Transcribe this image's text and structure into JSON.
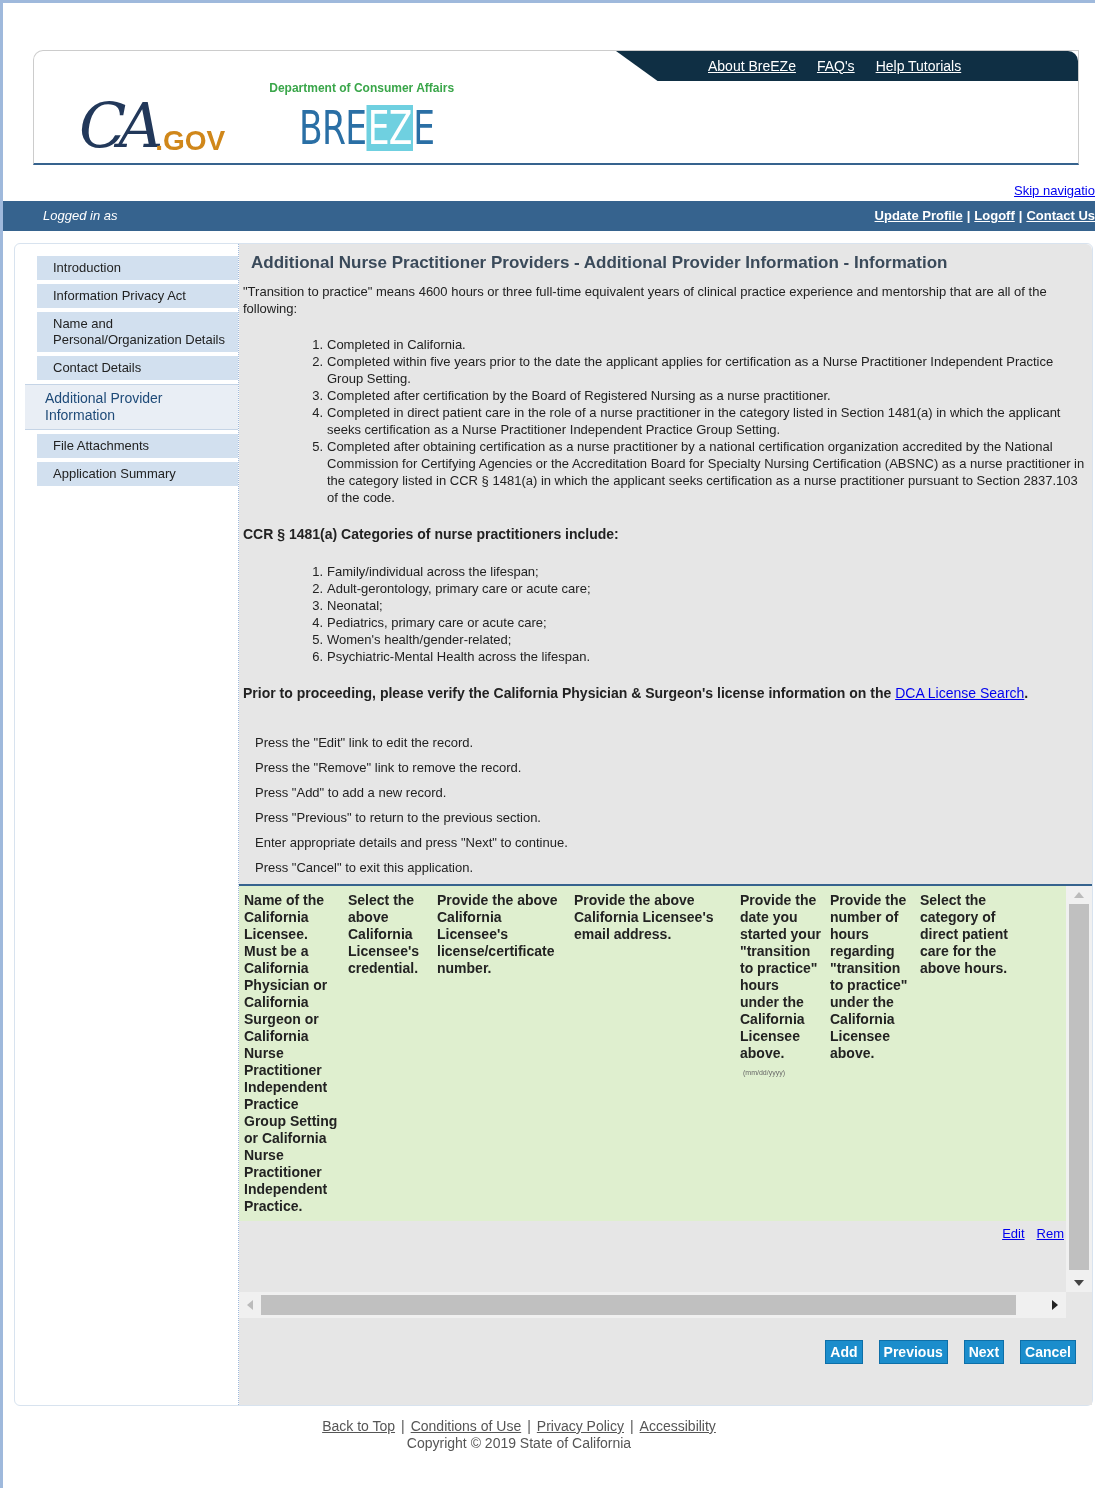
{
  "header": {
    "nav_links": [
      "About BreEZe",
      "FAQ's",
      "Help Tutorials"
    ],
    "ca_logo": {
      "main": "CA",
      ".gov": ".GOV"
    },
    "department": "Department of Consumer Affairs",
    "breeze_logo": [
      "BRE",
      "EZ",
      "E"
    ]
  },
  "skip_link": "Skip navigatio",
  "user_bar": {
    "logged_in": "Logged in as",
    "separator": "|",
    "links": [
      "Update Profile",
      "Logoff",
      "Contact Us"
    ]
  },
  "sidebar": {
    "items": [
      {
        "label": "Introduction",
        "selected": false
      },
      {
        "label": "Information Privacy Act",
        "selected": false
      },
      {
        "label": "Name and Personal/Organization Details",
        "selected": false
      },
      {
        "label": "Contact Details",
        "selected": false
      },
      {
        "label": "Additional Provider Information",
        "selected": true
      },
      {
        "label": "File Attachments",
        "selected": false
      },
      {
        "label": "Application Summary",
        "selected": false
      }
    ]
  },
  "main": {
    "title": "Additional Nurse Practitioner Providers - Additional Provider Information - Information",
    "intro": "\"Transition to practice\" means 4600 hours or three full-time equivalent years of clinical practice experience and mentorship that are all of the following:",
    "requirements": [
      {
        "number": "1.",
        "text": "Completed in California."
      },
      {
        "number": "2.",
        "text": "Completed within five years prior to the date the applicant applies for certification as a Nurse Practitioner Independent Practice Group Setting."
      },
      {
        "number": "3.",
        "text": "Completed after certification by the Board of Registered Nursing as a nurse practitioner."
      },
      {
        "number": "4.",
        "text": "Completed in direct patient care in the role of a nurse practitioner in the category listed in Section 1481(a) in which the applicant seeks certification as a Nurse Practitioner Independent Practice Group Setting."
      },
      {
        "number": "5.",
        "text": "Completed after obtaining certification as a nurse practitioner by a national certification organization accredited by the National Commission for Certifying Agencies or the Accreditation Board for Specialty Nursing Certification (ABSNC) as a nurse practitioner in the category listed in CCR § 1481(a) in which the applicant seeks certification as a nurse practitioner pursuant to Section 2837.103 of the code."
      }
    ],
    "categories_heading": "CCR § 1481(a) Categories of nurse practitioners include:",
    "categories": [
      {
        "number": "1.",
        "text": "Family/individual across the lifespan;"
      },
      {
        "number": "2.",
        "text": "Adult-gerontology, primary care or acute care;"
      },
      {
        "number": "3.",
        "text": "Neonatal;"
      },
      {
        "number": "4.",
        "text": "Pediatrics, primary care or acute care;"
      },
      {
        "number": "5.",
        "text": "Women's health/gender-related;"
      },
      {
        "number": "6.",
        "text": "Psychiatric-Mental Health across the lifespan."
      }
    ],
    "verify": {
      "text": "Prior to proceeding, please verify the California Physician & Surgeon's license information on the",
      "link": "DCA License Search",
      "end": "."
    },
    "instructions": [
      "Press the \"Edit\" link to edit the record.",
      "Press the \"Remove\" link to remove the record.",
      "Press \"Add\" to add a new record.",
      "Press \"Previous\" to return to the previous section.",
      "Enter appropriate details and press \"Next\" to continue.",
      "Press \"Cancel\" to exit this application."
    ],
    "table": {
      "columns": [
        {
          "label": "Name of the California Licensee. Must be a California Physician or California Surgeon or California Nurse Practitioner Independent Practice Group Setting or California Nurse Practitioner Independent Practice."
        },
        {
          "label": "Select the above California Licensee's credential."
        },
        {
          "label": "Provide the above California Licensee's license/certificate number."
        },
        {
          "label": "Provide the above California Licensee's email address."
        },
        {
          "label": "Provide the date you started your \"transition to practice\" hours under the California Licensee above.",
          "hint": "(mm/dd/yyyy)"
        },
        {
          "label": "Provide the number of hours regarding \"transition to practice\" under the California Licensee above."
        },
        {
          "label": "Select the category of direct patient care for the above hours."
        }
      ],
      "row_links": [
        "Edit",
        "Rem"
      ]
    },
    "buttons": [
      "Add",
      "Previous",
      "Next",
      "Cancel"
    ]
  },
  "footer": {
    "separator": "|",
    "links": [
      "Back to Top",
      "Conditions of Use",
      "Privacy Policy",
      "Accessibility"
    ],
    "copyright": "Copyright © 2019 State of California"
  }
}
